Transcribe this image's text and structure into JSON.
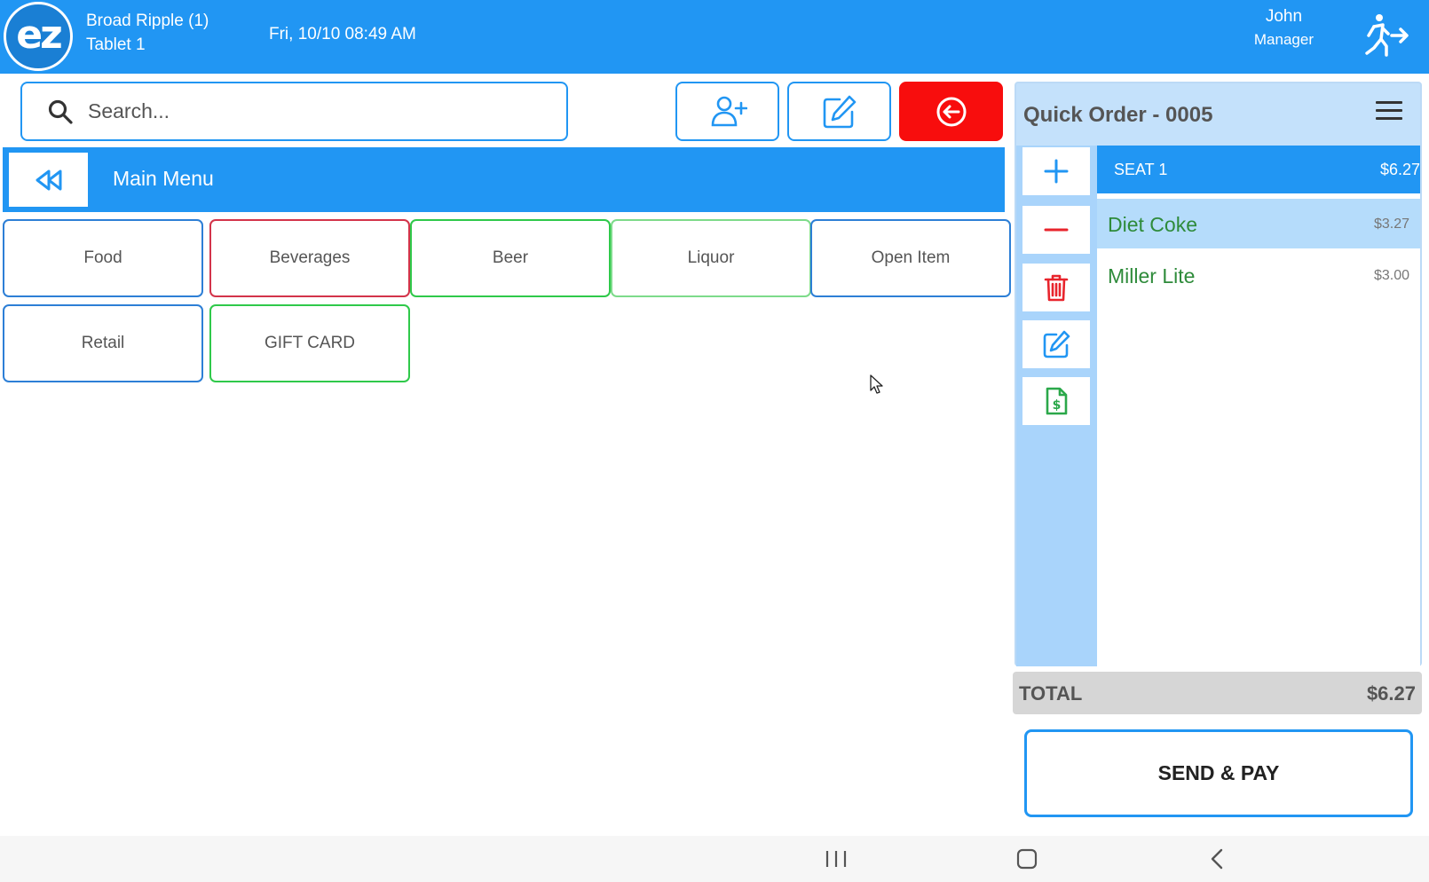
{
  "header": {
    "logo_text": "ez",
    "location": "Broad Ripple (1)",
    "device": "Tablet 1",
    "datetime": "Fri, 10/10 08:49 AM",
    "user_name": "John",
    "user_role": "Manager",
    "exit_icon": "running-exit-icon",
    "background": "#2196f3"
  },
  "toolbar": {
    "search_placeholder": "Search...",
    "search_icon": "search-icon",
    "add_customer_icon": "add-user-icon",
    "edit_icon": "edit-icon",
    "back_icon": "circle-arrow-left-icon",
    "back_color": "#f80d0d"
  },
  "menu": {
    "title": "Main Menu",
    "back_icon": "double-chevron-left-icon",
    "categories": [
      {
        "label": "Food",
        "border": "#2d7fd6"
      },
      {
        "label": "Beverages",
        "border": "#d3344a"
      },
      {
        "label": "Beer",
        "border": "#2fc94a"
      },
      {
        "label": "Liquor",
        "border": "#7ddb8a"
      },
      {
        "label": "Open Item",
        "border": "#2d7fd6"
      },
      {
        "label": "Retail",
        "border": "#2d7fd6"
      },
      {
        "label": "GIFT CARD",
        "border": "#2fc94a"
      }
    ]
  },
  "order": {
    "title": "Quick Order - 0005",
    "menu_icon": "hamburger-icon",
    "actions": [
      "plus-icon",
      "minus-icon",
      "trash-icon",
      "edit-icon",
      "receipt-dollar-icon"
    ],
    "seat": {
      "label": "SEAT 1",
      "total": "$6.27"
    },
    "items": [
      {
        "name": "Diet Coke",
        "price": "$3.27",
        "selected": true
      },
      {
        "name": "Miller Lite",
        "price": "$3.00",
        "selected": false
      }
    ],
    "total_label": "TOTAL",
    "total_value": "$6.27",
    "send_pay_label": "SEND & PAY"
  },
  "system_nav": [
    "recent-apps-icon",
    "home-icon",
    "back-icon"
  ]
}
